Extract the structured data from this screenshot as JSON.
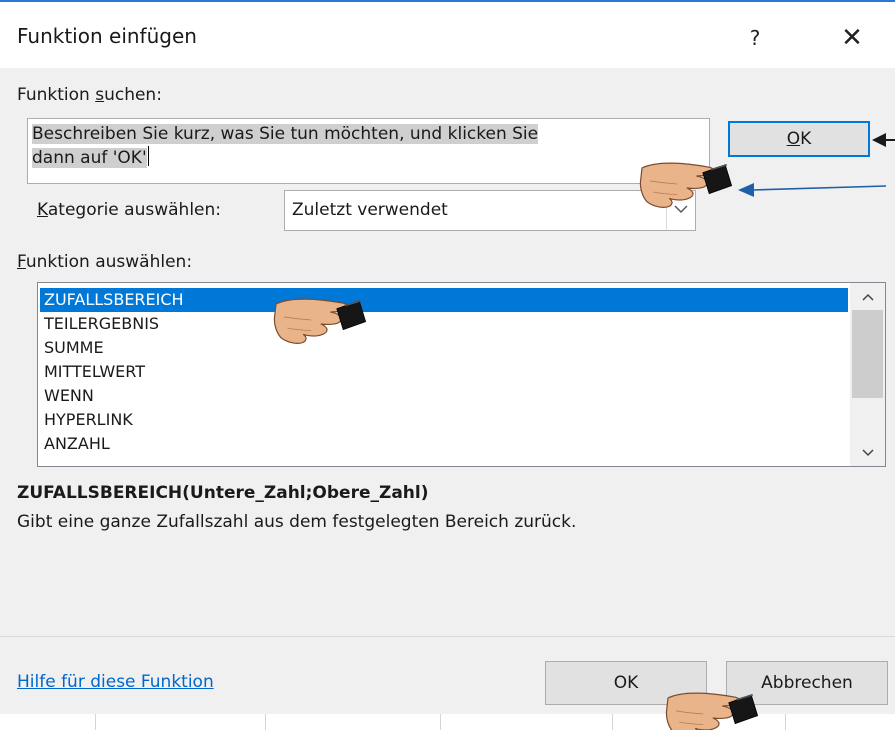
{
  "dialog": {
    "title": "Funktion einfügen",
    "help_icon": "?",
    "close_icon": "✕"
  },
  "search": {
    "label_prefix": "Funktion ",
    "label_accel": "s",
    "label_suffix": "uchen:",
    "value_line1": "Beschreiben Sie kurz, was Sie tun möchten, und klicken Sie",
    "value_line2": "dann auf 'OK'",
    "ok_accel": "O",
    "ok_suffix": "K"
  },
  "category": {
    "label_accel": "K",
    "label_suffix": "ategorie auswählen:",
    "value": "Zuletzt verwendet",
    "dropdown_icon": "chevron-down-icon"
  },
  "functions": {
    "label_accel": "F",
    "label_suffix": "unktion auswählen:",
    "items": [
      "ZUFALLSBEREICH",
      "TEILERGEBNIS",
      "SUMME",
      "MITTELWERT",
      "WENN",
      "HYPERLINK",
      "ANZAHL"
    ],
    "selected_index": 0
  },
  "details": {
    "signature": "ZUFALLSBEREICH(Untere_Zahl;Obere_Zahl)",
    "description": "Gibt eine ganze Zufallszahl aus dem festgelegten Bereich zurück."
  },
  "footer": {
    "help_link": "Hilfe für diese Funktion",
    "ok": "OK",
    "cancel": "Abbrechen"
  },
  "colors": {
    "accent": "#0078d7",
    "link": "#0066cc",
    "dialog_bg": "#f0f0f0",
    "annotation_arrow": "#1f5fa8"
  },
  "annotations": {
    "hand_icon": "pointing-hand-icon",
    "arrow_icon": "arrow-left-icon"
  }
}
